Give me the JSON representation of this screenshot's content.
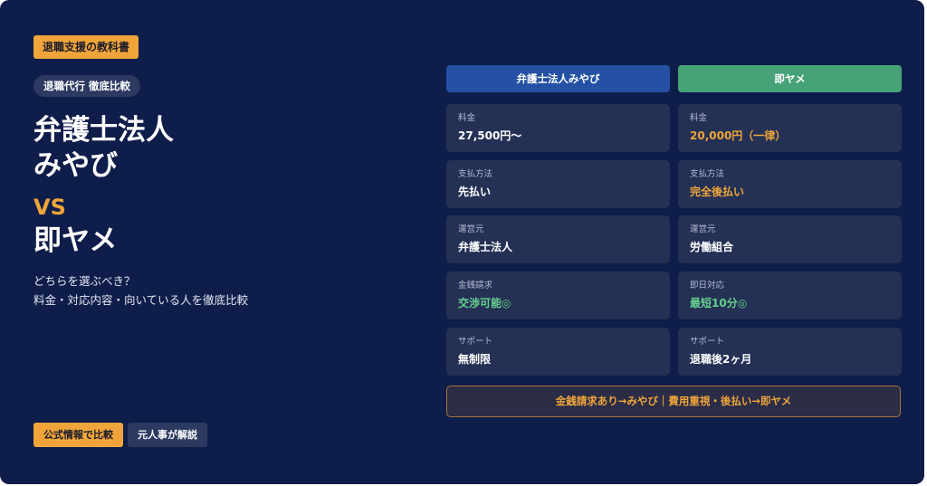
{
  "badge": "退職支援の教科書",
  "pill": "退職代行 徹底比較",
  "headline": {
    "line1": "弁護士法人",
    "line2": "みやび",
    "vs": "VS",
    "line3": "即ヤメ"
  },
  "subtitle": {
    "line1": "どちらを選ぶべき？",
    "line2": "料金・対応内容・向いている人を徹底比較"
  },
  "buttons": {
    "official": "公式情報で比較",
    "expert": "元人事が解説"
  },
  "columns": {
    "a": "弁護士法人みやび",
    "b": "即ヤメ"
  },
  "rows": [
    {
      "a": {
        "label": "料金",
        "value": "27,500円〜"
      },
      "b": {
        "label": "料金",
        "value": "20,000円（一律）"
      }
    },
    {
      "a": {
        "label": "支払方法",
        "value": "先払い"
      },
      "b": {
        "label": "支払方法",
        "value": "完全後払い"
      }
    },
    {
      "a": {
        "label": "運営元",
        "value": "弁護士法人"
      },
      "b": {
        "label": "運営元",
        "value": "労働組合"
      }
    },
    {
      "a": {
        "label": "金銭請求",
        "value": "交渉可能◎"
      },
      "b": {
        "label": "即日対応",
        "value": "最短10分◎"
      }
    },
    {
      "a": {
        "label": "サポート",
        "value": "無制限"
      },
      "b": {
        "label": "サポート",
        "value": "退職後2ヶ月"
      }
    }
  ],
  "summary": "金銭請求あり→みやび｜費用重視・後払い→即ヤメ",
  "colors": {
    "background": "#0f1d4a",
    "accent_orange": "#f0a53a",
    "column_a": "#2451a3",
    "column_b": "#48a278",
    "highlight_green": "#66d28e"
  }
}
